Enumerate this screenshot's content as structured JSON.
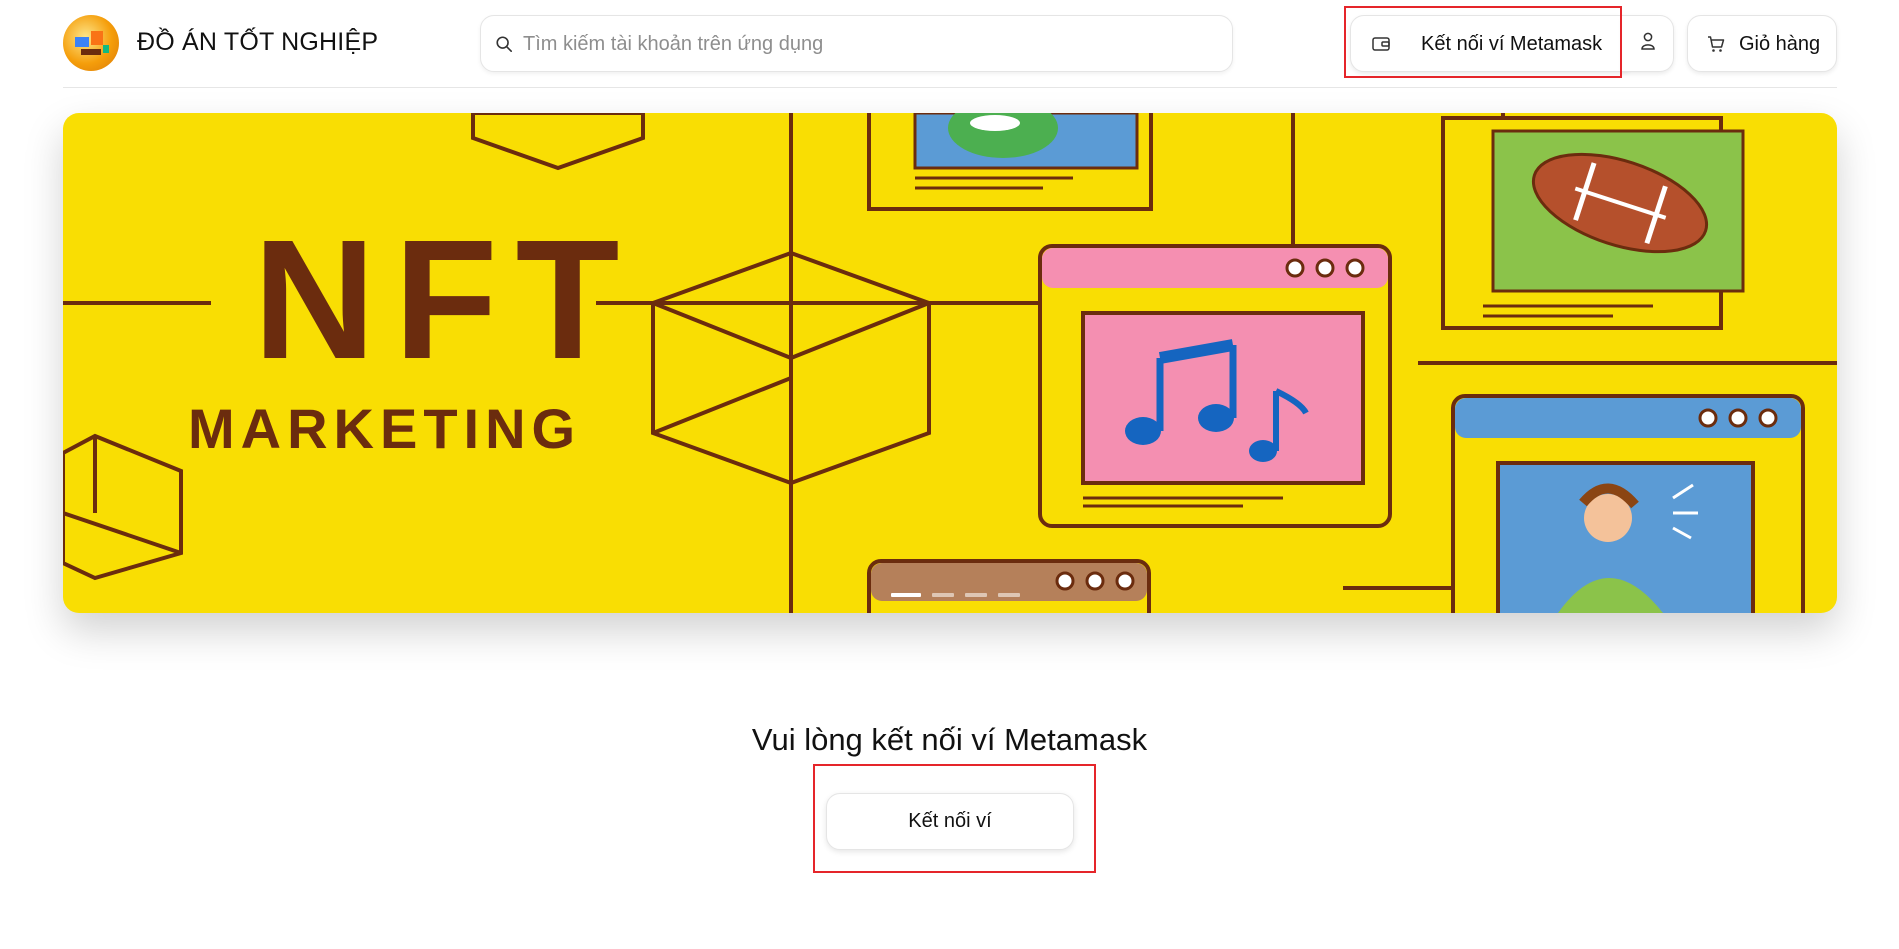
{
  "header": {
    "brand": "ĐỒ ÁN TỐT NGHIỆP",
    "search_placeholder": "Tìm kiếm tài khoản trên ứng dụng",
    "connect_metamask_label": "Kết nối ví Metamask",
    "cart_label": "Giỏ hàng"
  },
  "banner": {
    "headline": "NFT",
    "subheadline": "MARKETING",
    "slides_total": 4,
    "active_slide": 1
  },
  "main": {
    "prompt": "Vui lòng kết nối ví Metamask",
    "connect_button_label": "Kết nối ví"
  },
  "colors": {
    "accent_highlight": "#e5252a",
    "banner_bg": "#f9de03",
    "banner_text": "#6b2c0e"
  }
}
